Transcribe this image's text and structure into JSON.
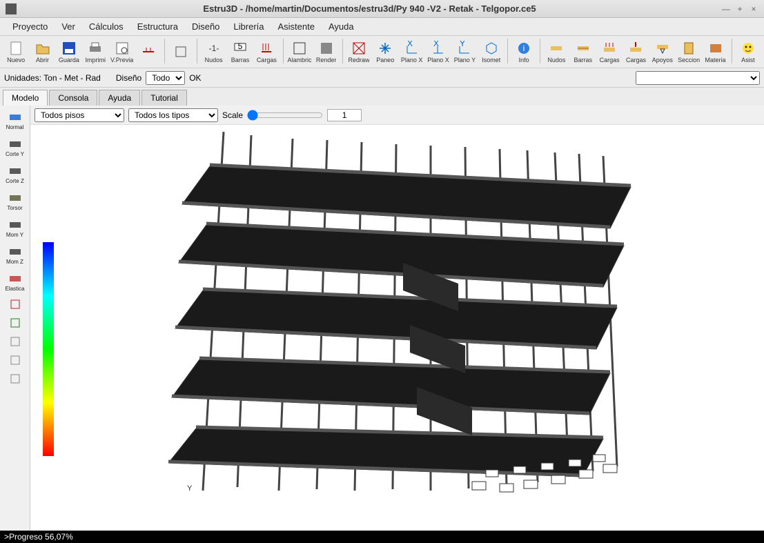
{
  "title": "Estru3D - /home/martin/Documentos/estru3d/Py 940 -V2 - Retak - Telgopor.ce5",
  "menu": [
    "Proyecto",
    "Ver",
    "Cálculos",
    "Estructura",
    "Diseño",
    "Librería",
    "Asistente",
    "Ayuda"
  ],
  "toolbar": [
    {
      "label": "Nuevo",
      "icon": "file"
    },
    {
      "label": "Abrir",
      "icon": "folder"
    },
    {
      "label": "Guarda",
      "icon": "save"
    },
    {
      "label": "Imprimi",
      "icon": "print"
    },
    {
      "label": "V.Previa",
      "icon": "preview"
    },
    {
      "label": "",
      "icon": "misc1",
      "sep": true
    },
    {
      "label": "",
      "icon": "misc2"
    },
    {
      "label": "Nudos",
      "icon": "nudo",
      "sepBefore": true
    },
    {
      "label": "Barras",
      "icon": "barra"
    },
    {
      "label": "Cargas",
      "icon": "carga"
    },
    {
      "label": "Alambric",
      "icon": "wire",
      "sepBefore": true
    },
    {
      "label": "Render",
      "icon": "render"
    },
    {
      "label": "Redraw",
      "icon": "redraw",
      "sepBefore": true
    },
    {
      "label": "Paneo",
      "icon": "pan"
    },
    {
      "label": "Plano X",
      "icon": "px"
    },
    {
      "label": "Plano X",
      "icon": "px2"
    },
    {
      "label": "Plano Y",
      "icon": "py"
    },
    {
      "label": "Isomet",
      "icon": "iso"
    },
    {
      "label": "Info",
      "icon": "info",
      "sepBefore": true
    },
    {
      "label": "Nudos",
      "icon": "nudos2",
      "sepBefore": true
    },
    {
      "label": "Barras",
      "icon": "barras2"
    },
    {
      "label": "Cargas",
      "icon": "cargas2"
    },
    {
      "label": "Cargas",
      "icon": "cargas3"
    },
    {
      "label": "Apoyos",
      "icon": "apoyos"
    },
    {
      "label": "Seccion",
      "icon": "seccion"
    },
    {
      "label": "Materia",
      "icon": "material"
    },
    {
      "label": "Asist",
      "icon": "asist",
      "sepBefore": true
    }
  ],
  "options": {
    "unidades_label": "Unidades: Ton - Met - Rad",
    "diseno_label": "Diseño",
    "diseno_value": "Todo",
    "ok_label": "OK"
  },
  "tabs": [
    "Modelo",
    "Consola",
    "Ayuda",
    "Tutorial"
  ],
  "active_tab": 0,
  "leftbar": [
    {
      "label": "Normal",
      "color": "#1060d0"
    },
    {
      "label": "Corte Y",
      "color": "#333"
    },
    {
      "label": "Corte Z",
      "color": "#333"
    },
    {
      "label": "Torsor",
      "color": "#553"
    },
    {
      "label": "Mom Y",
      "color": "#333"
    },
    {
      "label": "Mom Z",
      "color": "#333"
    },
    {
      "label": "Elastica",
      "color": "#c03030"
    }
  ],
  "viewport": {
    "pisos_label": "Todos pisos",
    "tipos_label": "Todos los tipos",
    "scale_label": "Scale",
    "scale_value": "1"
  },
  "axis_label": "Y",
  "status": ">Progreso 56,07%"
}
